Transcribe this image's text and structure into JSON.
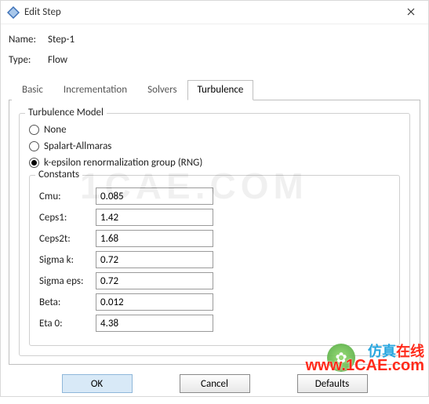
{
  "titlebar": {
    "title": "Edit Step"
  },
  "header": {
    "name_label": "Name:",
    "name_value": "Step-1",
    "type_label": "Type:",
    "type_value": "Flow"
  },
  "tabs": {
    "basic": "Basic",
    "incrementation": "Incrementation",
    "solvers": "Solvers",
    "turbulence": "Turbulence"
  },
  "groups": {
    "turb_model_title": "Turbulence Model",
    "constants_title": "Constants"
  },
  "radios": {
    "none": "None",
    "spalart": "Spalart-Allmaras",
    "kerng": "k-epsilon renormalization group (RNG)"
  },
  "constants": {
    "cmu_label": "Cmu:",
    "cmu_value": "0.085",
    "ceps1_label": "Ceps1:",
    "ceps1_value": "1.42",
    "ceps2t_label": "Ceps2t:",
    "ceps2t_value": "1.68",
    "sigmak_label": "Sigma k:",
    "sigmak_value": "0.72",
    "sigmaeps_label": "Sigma eps:",
    "sigmaeps_value": "0.72",
    "beta_label": "Beta:",
    "beta_value": "0.012",
    "eta0_label": "Eta 0:",
    "eta0_value": "4.38"
  },
  "buttons": {
    "ok": "OK",
    "cancel": "Cancel",
    "defaults": "Defaults"
  },
  "watermarks": {
    "big": "1CAE.COM",
    "red": "www.1CAE.com",
    "blue_prefix": "仿真",
    "blue_red": "在线"
  }
}
